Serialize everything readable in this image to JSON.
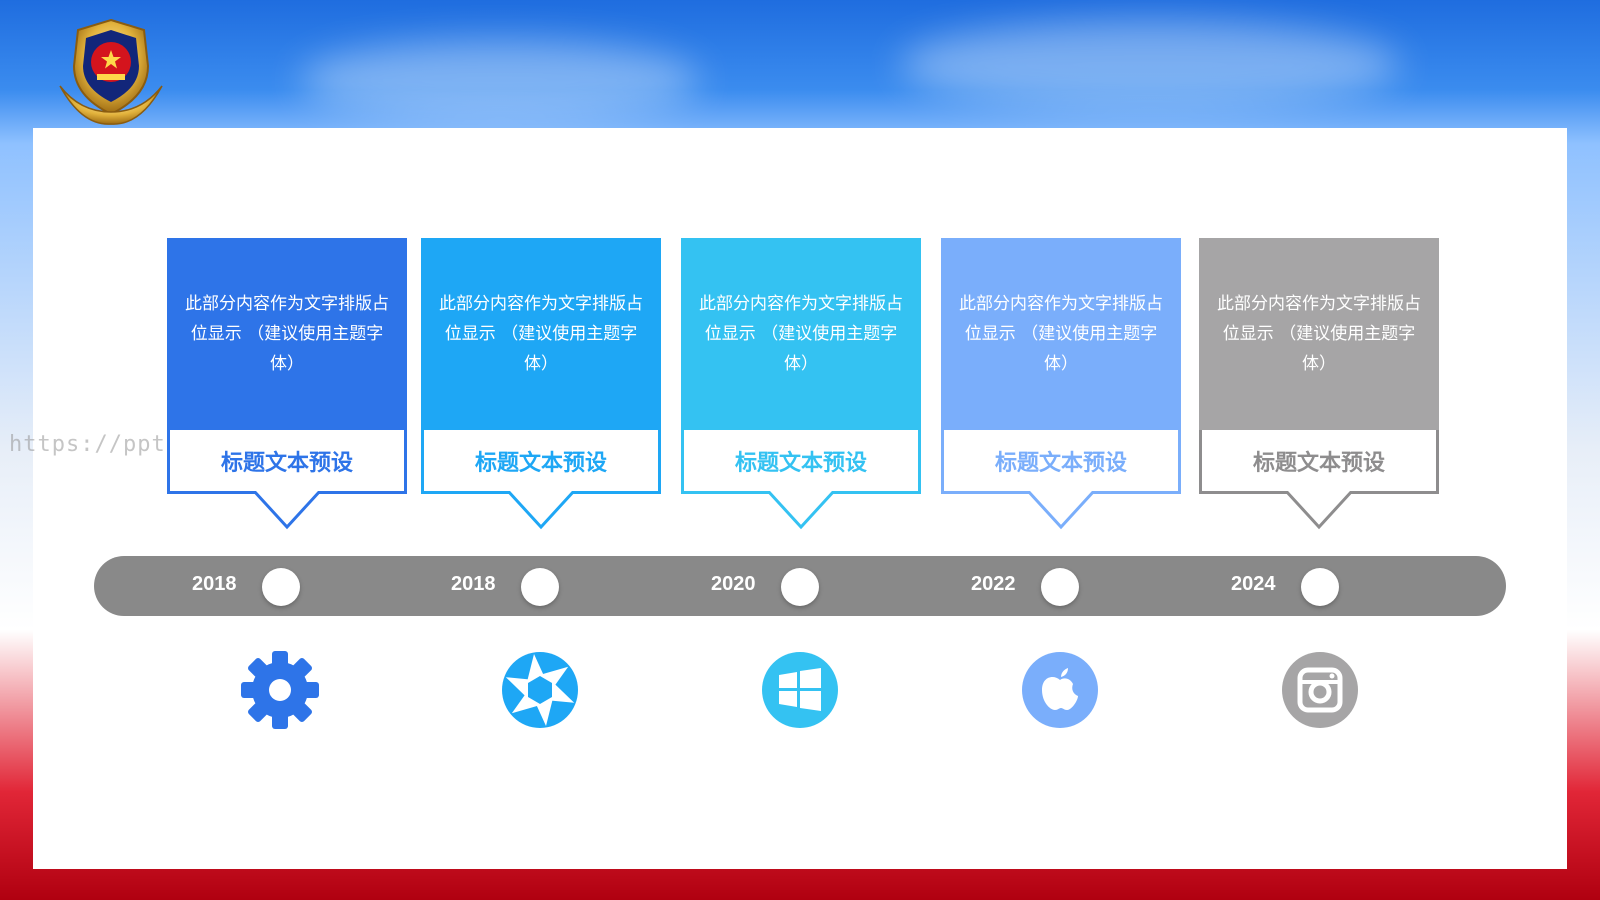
{
  "watermark": "https://ppt.pkll.de",
  "timeline": [
    {
      "year": "2018",
      "body": "此部分内容作为文字排版占位显示 （建议使用主题字体）",
      "title": "标题文本预设",
      "color": "#2e74e8",
      "icon": "gear-icon"
    },
    {
      "year": "2018",
      "body": "此部分内容作为文字排版占位显示 （建议使用主题字体）",
      "title": "标题文本预设",
      "color": "#1ea7f5",
      "icon": "camera-aperture-icon"
    },
    {
      "year": "2020",
      "body": "此部分内容作为文字排版占位显示 （建议使用主题字体）",
      "title": "标题文本预设",
      "color": "#34c2f2",
      "icon": "windows-icon"
    },
    {
      "year": "2022",
      "body": "此部分内容作为文字排版占位显示 （建议使用主题字体）",
      "title": "标题文本预设",
      "color": "#7aaefb",
      "icon": "apple-icon"
    },
    {
      "year": "2024",
      "body": "此部分内容作为文字排版占位显示 （建议使用主题字体）",
      "title": "标题文本预设",
      "color": "#a6a5a6",
      "icon": "instagram-icon"
    }
  ],
  "colors": {
    "bar": "#898989",
    "frame_red": "#c0001a",
    "sky_blue": "#2a73e0"
  }
}
